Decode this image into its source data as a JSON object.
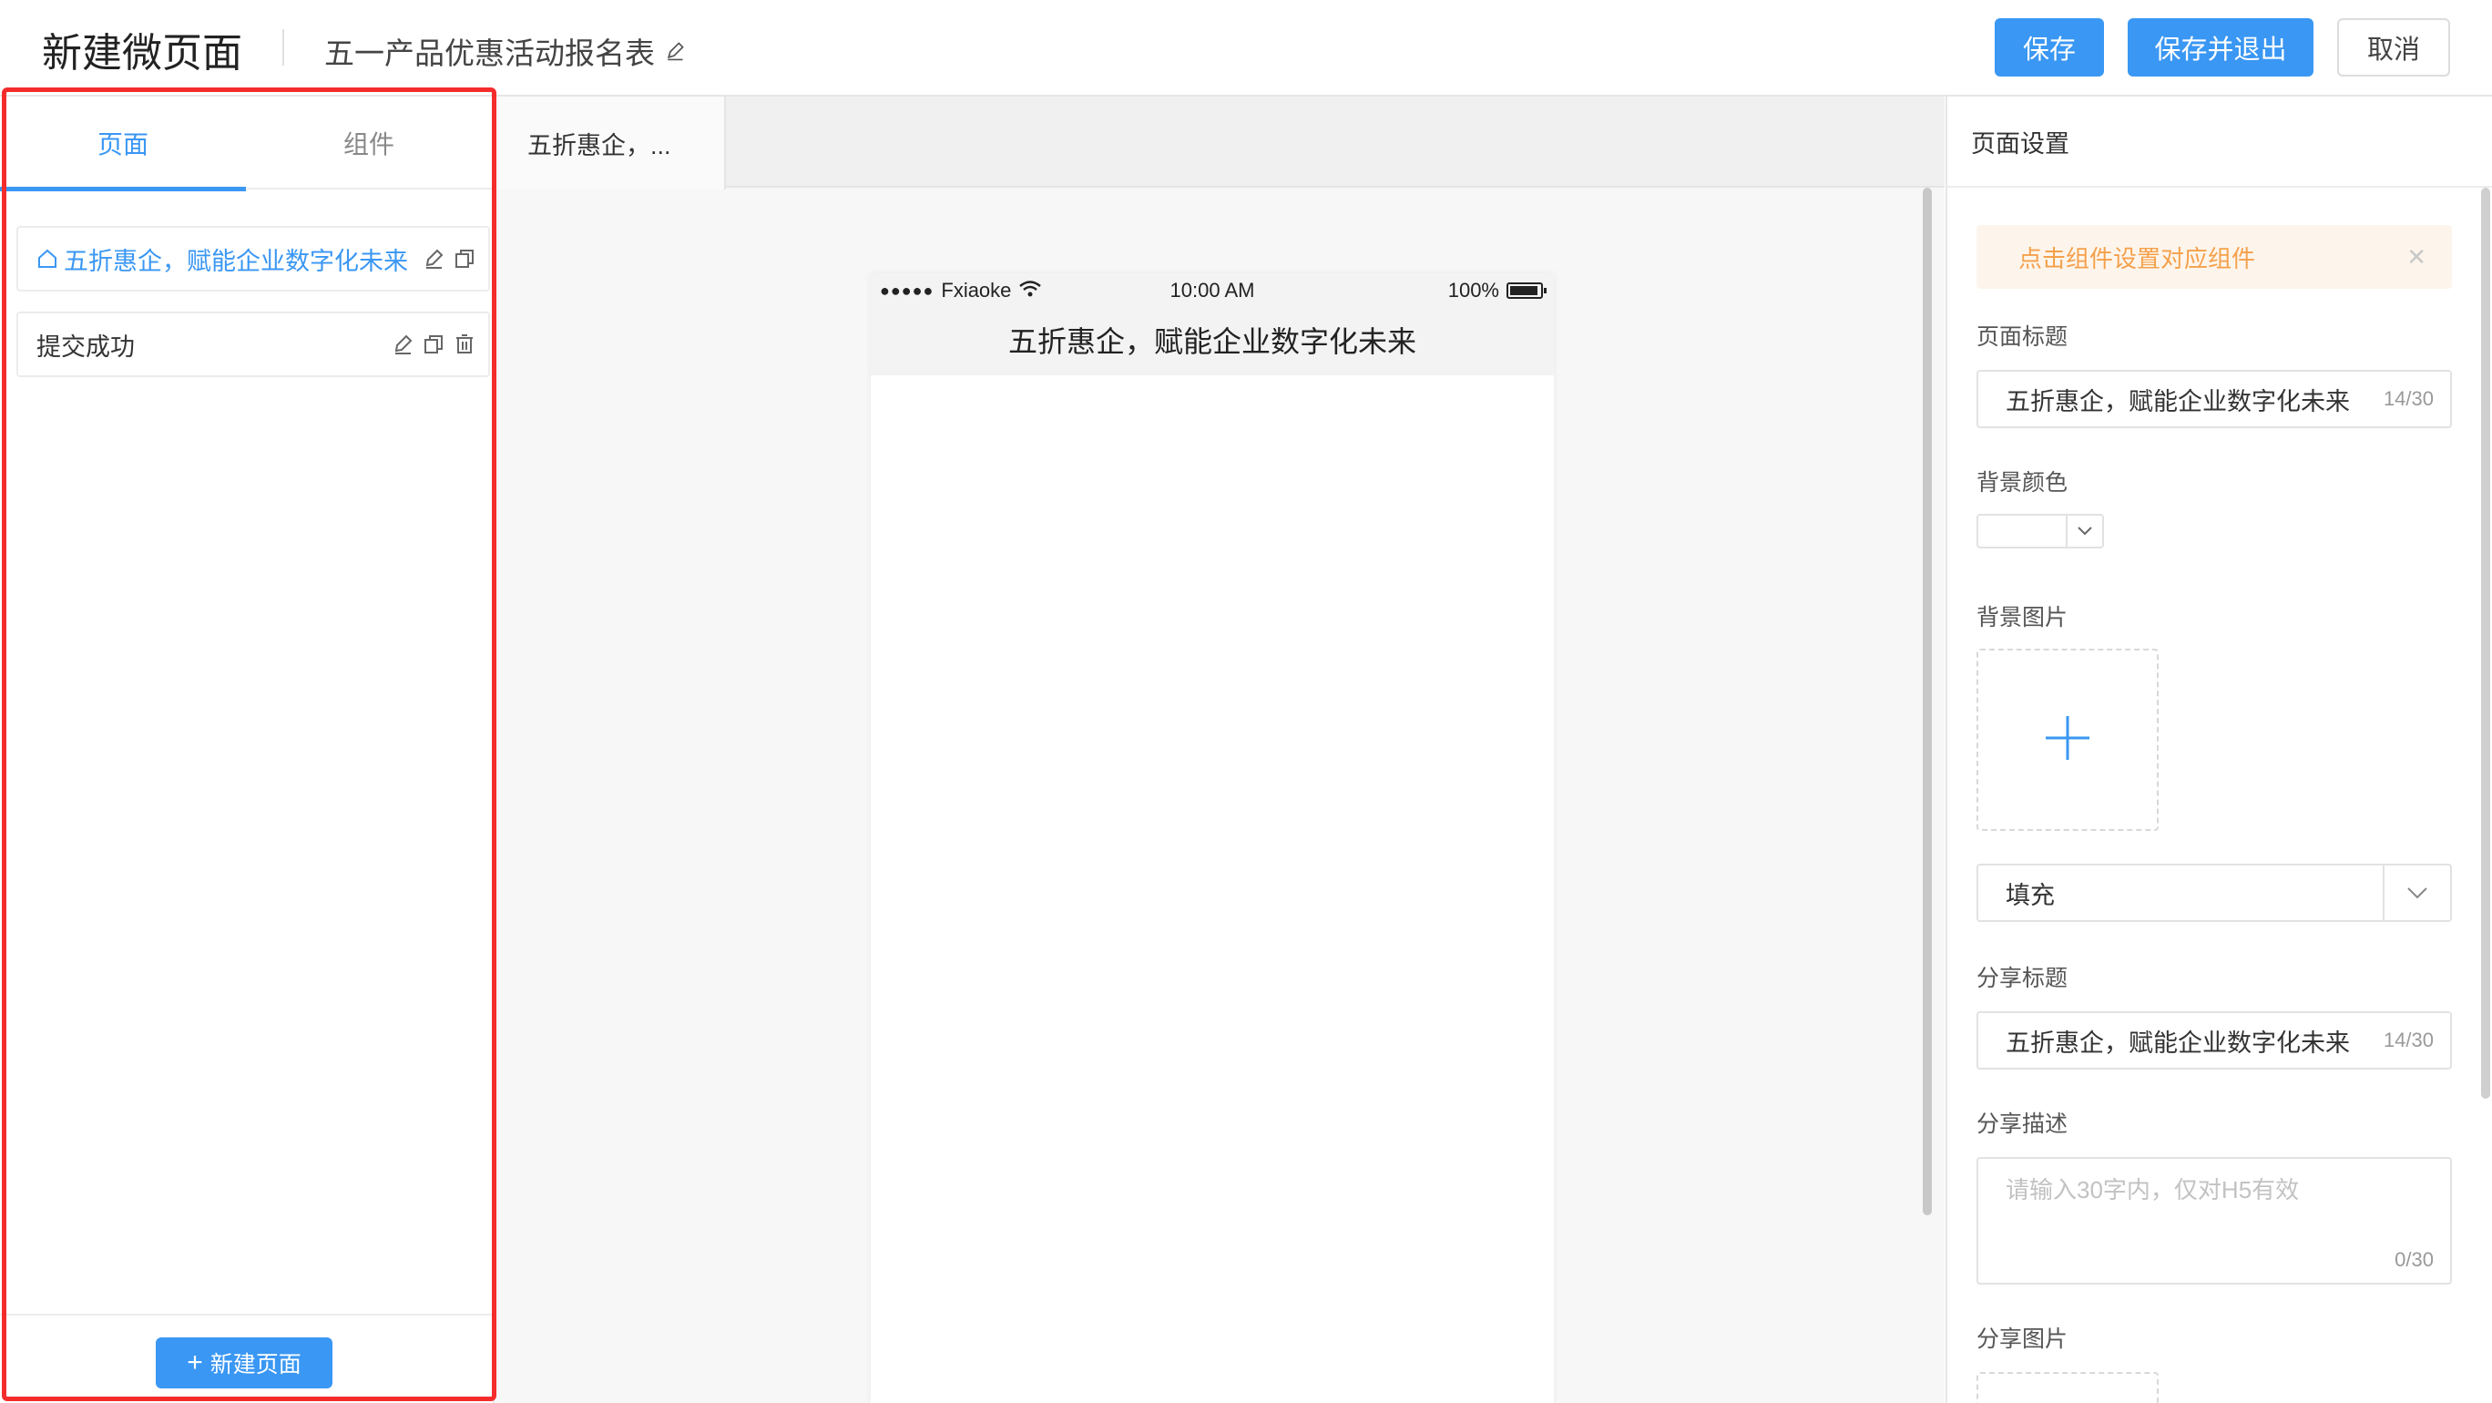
{
  "header": {
    "title": "新建微页面",
    "form_name": "五一产品优惠活动报名表",
    "save_label": "保存",
    "save_exit_label": "保存并退出",
    "cancel_label": "取消"
  },
  "left": {
    "tabs": [
      {
        "label": "页面",
        "active": true
      },
      {
        "label": "组件",
        "active": false
      }
    ],
    "pages": [
      {
        "label": "五折惠企，赋能企业数字化未来",
        "home": true,
        "active": true
      },
      {
        "label": "提交成功",
        "home": false,
        "active": false
      }
    ],
    "new_page_label": "新建页面"
  },
  "middle": {
    "tab_label": "五折惠企，...",
    "phone": {
      "carrier": "Fxiaoke",
      "time": "10:00 AM",
      "battery": "100%",
      "title": "五折惠企，赋能企业数字化未来"
    }
  },
  "right": {
    "header": "页面设置",
    "alert": "点击组件设置对应组件",
    "page_title_label": "页面标题",
    "page_title_value": "五折惠企，赋能企业数字化未来",
    "page_title_count": "14/30",
    "bg_color_label": "背景颜色",
    "bg_image_label": "背景图片",
    "fill_mode": "填充",
    "share_title_label": "分享标题",
    "share_title_value": "五折惠企，赋能企业数字化未来",
    "share_title_count": "14/30",
    "share_desc_label": "分享描述",
    "share_desc_placeholder": "请输入30字内，仅对H5有效",
    "share_desc_count": "0/30",
    "share_image_label": "分享图片"
  },
  "colors": {
    "primary": "#3a97f3",
    "highlight_border": "#f52c2c",
    "alert_text": "#f5a04a",
    "alert_bg": "#fdf5ec"
  }
}
